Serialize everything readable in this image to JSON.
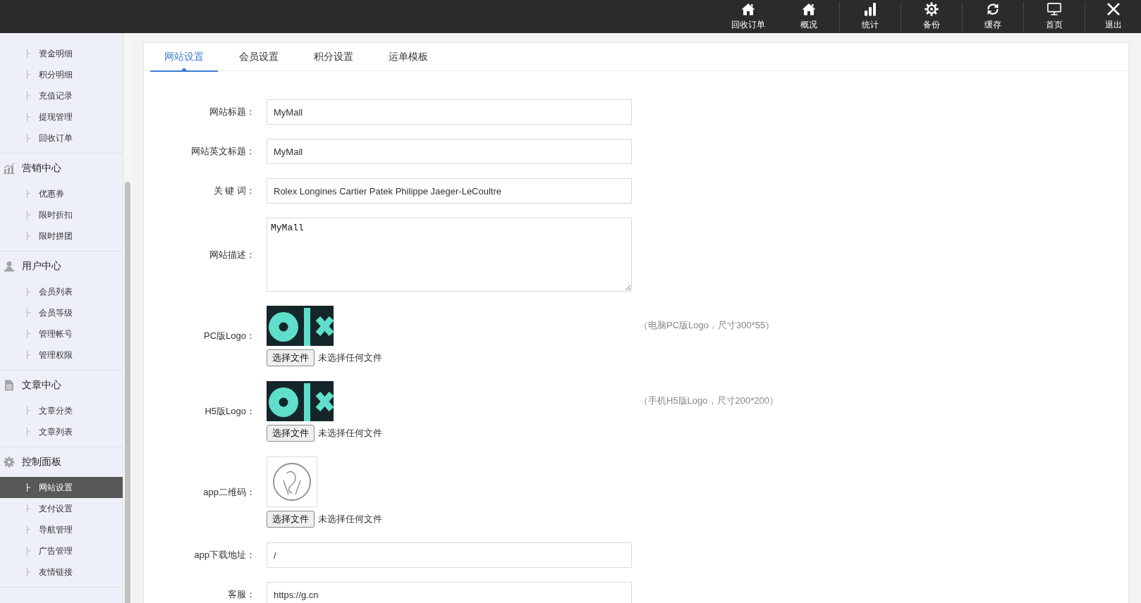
{
  "top_nav": {
    "groups": [
      {
        "items": [
          {
            "label": "回收订单"
          },
          {
            "label": "概况"
          }
        ]
      },
      {
        "items": [
          {
            "label": "统计"
          }
        ]
      },
      {
        "items": [
          {
            "label": "备份"
          }
        ]
      },
      {
        "items": [
          {
            "label": "缓存"
          }
        ]
      },
      {
        "items": [
          {
            "label": "首页"
          }
        ]
      },
      {
        "items": [
          {
            "label": "退出"
          }
        ]
      }
    ]
  },
  "sidebar": {
    "groups": [
      {
        "items": [
          {
            "label": "资金明细",
            "selected": false
          },
          {
            "label": "积分明细",
            "selected": false
          },
          {
            "label": "充值记录",
            "selected": false
          },
          {
            "label": "提现管理",
            "selected": false
          },
          {
            "label": "回收订单",
            "selected": false
          }
        ]
      },
      {
        "title": "营销中心",
        "items": [
          {
            "label": "优惠券",
            "selected": false
          },
          {
            "label": "限时折扣",
            "selected": false
          },
          {
            "label": "限时拼团",
            "selected": false
          }
        ]
      },
      {
        "title": "用户中心",
        "items": [
          {
            "label": "会员列表",
            "selected": false
          },
          {
            "label": "会员等级",
            "selected": false
          },
          {
            "label": "管理帐号",
            "selected": false
          },
          {
            "label": "管理权限",
            "selected": false
          }
        ]
      },
      {
        "title": "文章中心",
        "items": [
          {
            "label": "文章分类",
            "selected": false
          },
          {
            "label": "文章列表",
            "selected": false
          }
        ]
      },
      {
        "title": "控制面板",
        "items": [
          {
            "label": "网站设置",
            "selected": true
          },
          {
            "label": "支付设置",
            "selected": false
          },
          {
            "label": "导航管理",
            "selected": false
          },
          {
            "label": "广告管理",
            "selected": false
          },
          {
            "label": "友情链接",
            "selected": false
          }
        ]
      }
    ]
  },
  "tabs": [
    {
      "label": "网站设置",
      "selected": true
    },
    {
      "label": "会员设置",
      "selected": false
    },
    {
      "label": "积分设置",
      "selected": false
    },
    {
      "label": "运单模板",
      "selected": false
    }
  ],
  "form": {
    "fields": [
      {
        "kind": "text",
        "label": "网站标题：",
        "value": "MyMall"
      },
      {
        "kind": "text",
        "label": "网站英文标题：",
        "value": "MyMall"
      },
      {
        "kind": "text",
        "label": "关 键 词：",
        "value": "Rolex Longines Cartier Patek Philippe Jaeger-LeCoultre"
      },
      {
        "kind": "textarea",
        "label": "网站描述：",
        "value": "MyMall"
      },
      {
        "kind": "upload",
        "label": "PC版Logo：",
        "button": "选择文件",
        "file_status": "未选择任何文件",
        "hint": "（电脑PC版Logo，尺寸300*55）"
      },
      {
        "kind": "upload",
        "label": "H5版Logo：",
        "button": "选择文件",
        "file_status": "未选择任何文件",
        "hint": "（手机H5版Logo，尺寸200*200）"
      },
      {
        "kind": "upload",
        "label": "app二维码：",
        "button": "选择文件",
        "file_status": "未选择任何文件"
      },
      {
        "kind": "text",
        "label": "app下载地址：",
        "value": "/"
      },
      {
        "kind": "text",
        "label": "客服：",
        "value": "https://g.cn"
      }
    ]
  }
}
